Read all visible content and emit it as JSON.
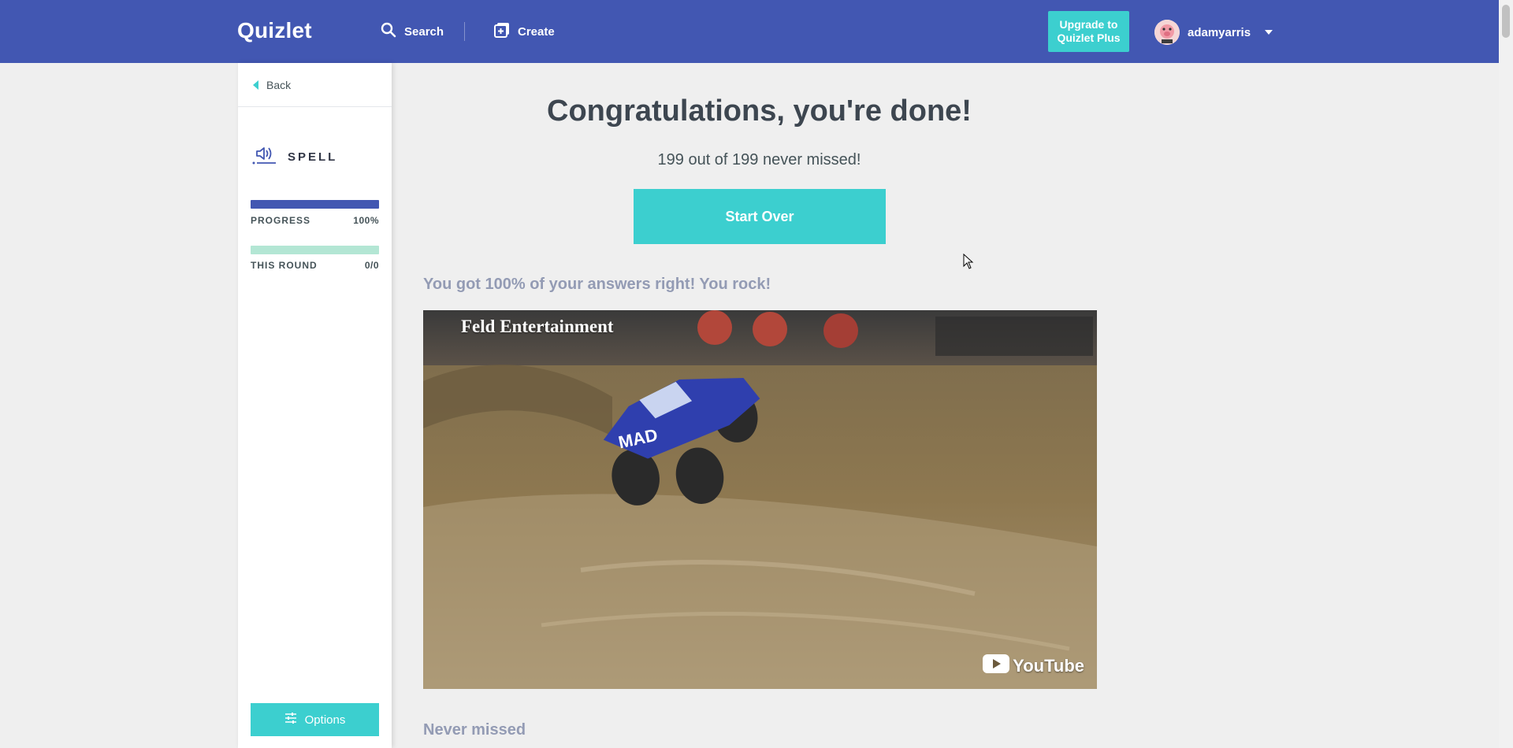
{
  "header": {
    "logo": "Quizlet",
    "search_label": "Search",
    "create_label": "Create",
    "upgrade_line1": "Upgrade to",
    "upgrade_line2": "Quizlet Plus",
    "username": "adamyarris"
  },
  "sidebar": {
    "back_label": "Back",
    "mode_label": "SPELL",
    "mode_icon": "speaker-icon",
    "progress_label": "PROGRESS",
    "progress_value": "100%",
    "progress_fraction": 1.0,
    "round_label": "THIS ROUND",
    "round_value": "0/0",
    "options_label": "Options"
  },
  "main": {
    "title": "Congratulations, you're done!",
    "subtitle": "199 out of 199 never missed!",
    "start_over_label": "Start Over",
    "result_message": "You got 100% of your answers right! You rock!",
    "video_caption": "Feld Entertainment",
    "video_badge": "YouTube",
    "never_missed_heading": "Never missed"
  },
  "colors": {
    "header_bg": "#4257b2",
    "accent": "#3ccfcf",
    "progress_bar": "#4257b2",
    "round_bar": "#b3e6d4",
    "page_bg": "#efefef"
  }
}
